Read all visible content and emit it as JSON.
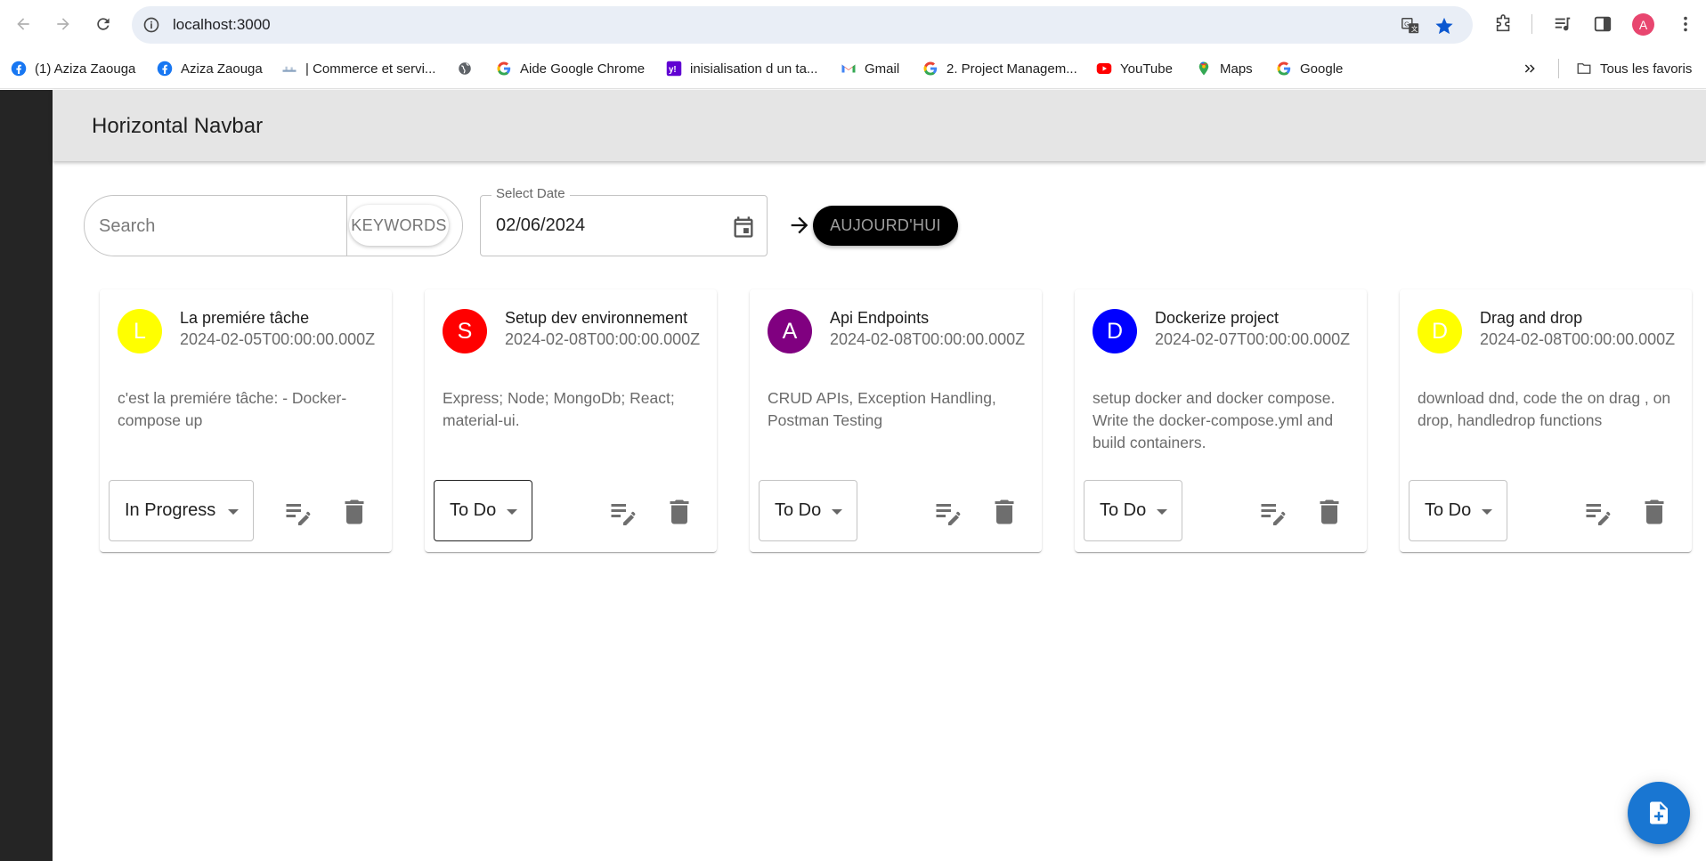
{
  "browser": {
    "url": "localhost:3000",
    "bookmarks": [
      {
        "label": "(1) Aziza Zaouga",
        "icon": "facebook-icon"
      },
      {
        "label": "Aziza Zaouga",
        "icon": "facebook-icon"
      },
      {
        "label": "| Commerce et servi...",
        "icon": "site-icon"
      },
      {
        "label": "",
        "icon": "globe-icon"
      },
      {
        "label": "Aide Google Chrome",
        "icon": "google-icon"
      },
      {
        "label": "inisialisation d un ta...",
        "icon": "yahoo-icon"
      },
      {
        "label": "Gmail",
        "icon": "gmail-icon"
      },
      {
        "label": "2. Project Managem...",
        "icon": "google-icon"
      },
      {
        "label": "YouTube",
        "icon": "youtube-icon"
      },
      {
        "label": "Maps",
        "icon": "maps-icon"
      },
      {
        "label": "Google",
        "icon": "google-icon"
      }
    ],
    "all_bookmarks": "Tous les favoris",
    "profile_initial": "A"
  },
  "app": {
    "title": "Horizontal Navbar",
    "search_placeholder": "Search",
    "keywords_label": "KEYWORDS",
    "date_label": "Select Date",
    "date_value": "02/06/2024",
    "today_label": "AUJOURD'HUI"
  },
  "tasks": [
    {
      "initial": "L",
      "color": "#ffff00",
      "title": "La premiére tâche",
      "date": "2024-02-05T00:00:00.000Z",
      "description": "c'est la premiére tâche: - Docker-compose up",
      "status": "In Progress"
    },
    {
      "initial": "S",
      "color": "#ff0000",
      "title": "Setup dev environnement",
      "date": "2024-02-08T00:00:00.000Z",
      "description": "Express; Node; MongoDb; React; material-ui.",
      "status": "To Do"
    },
    {
      "initial": "A",
      "color": "#800080",
      "title": "Api Endpoints",
      "date": "2024-02-08T00:00:00.000Z",
      "description": "CRUD APIs, Exception Handling, Postman Testing",
      "status": "To Do"
    },
    {
      "initial": "D",
      "color": "#0000ff",
      "title": "Dockerize project",
      "date": "2024-02-07T00:00:00.000Z",
      "description": "setup docker and docker compose. Write the docker-compose.yml and build containers.",
      "status": "To Do"
    },
    {
      "initial": "D",
      "color": "#ffff00",
      "title": "Drag and drop",
      "date": "2024-02-08T00:00:00.000Z",
      "description": "download dnd, code the on drag , on drop, handledrop functions",
      "status": "To Do"
    }
  ],
  "colors": {
    "accent": "#1976d2",
    "appbar": "#e5e5e5",
    "sidebar": "#252525"
  }
}
